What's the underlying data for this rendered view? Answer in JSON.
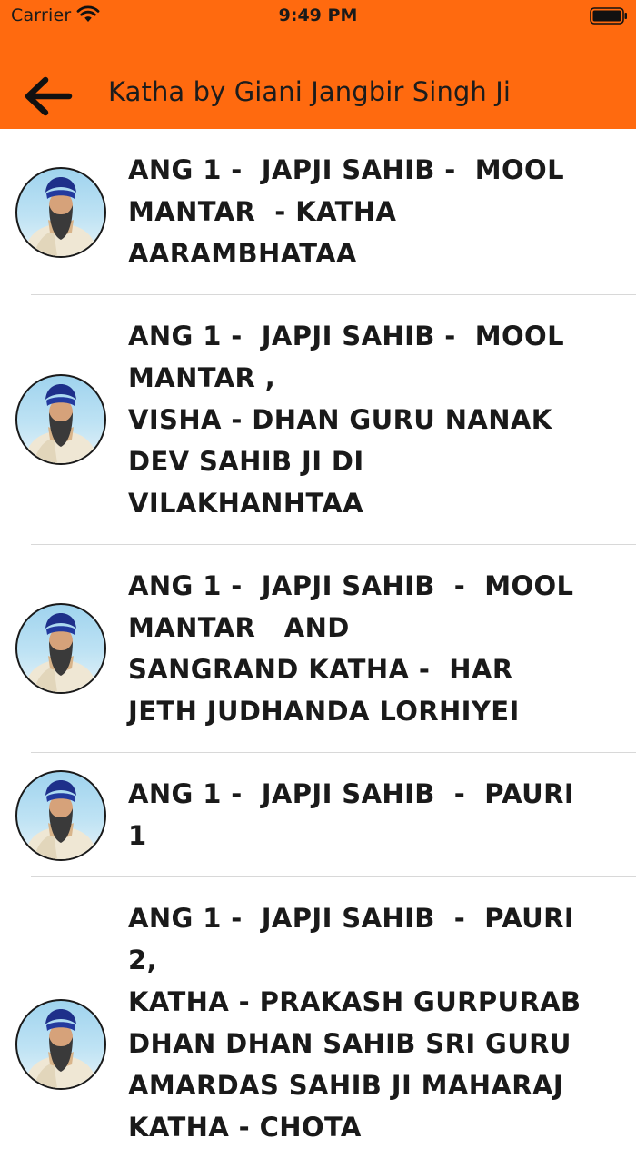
{
  "status_bar": {
    "carrier": "Carrier",
    "time": "9:49 PM",
    "wifi_icon": "wifi-icon",
    "battery_icon": "battery-icon"
  },
  "nav": {
    "title": "Katha by Giani Jangbir Singh Ji",
    "back_icon": "arrow-left-icon",
    "bar_color": "#ff6a0f"
  },
  "katha_list": [
    {
      "title": "ANG 1 -  JAPJI SAHIB -  MOOL\nMANTAR  - KATHA\nAARAMBHATAA",
      "avatar": "speaker-portrait"
    },
    {
      "title": "ANG 1 -  JAPJI SAHIB -  MOOL\nMANTAR ,\nVISHA - DHAN GURU NANAK\nDEV SAHIB JI DI\nVILAKHANHTAA",
      "avatar": "speaker-portrait"
    },
    {
      "title": "ANG 1 -  JAPJI SAHIB  -  MOOL\nMANTAR   AND\nSANGRAND KATHA -  HAR\nJETH JUDHANDA LORHIYEI",
      "avatar": "speaker-portrait"
    },
    {
      "title": "ANG 1 -  JAPJI SAHIB  -  PAURI\n1",
      "avatar": "speaker-portrait"
    },
    {
      "title": "ANG 1 -  JAPJI SAHIB  -  PAURI\n2,\nKATHA - PRAKASH GURPURAB\nDHAN DHAN SAHIB SRI GURU\nAMARDAS SAHIB JI MAHARAJ\nKATHA - CHOTA",
      "avatar": "speaker-portrait"
    }
  ]
}
